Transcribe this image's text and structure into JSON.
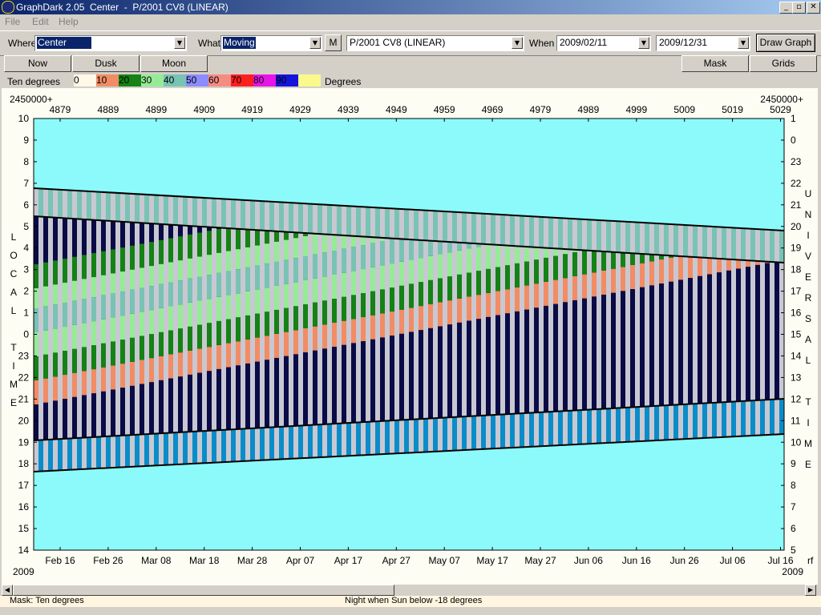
{
  "window": {
    "title": "GraphDark 2.05  Center  -  P/2001 CV8 (LINEAR)",
    "min_glyph": "_",
    "max_glyph": "▫",
    "close_glyph": "✕"
  },
  "menu": [
    {
      "label": "File"
    },
    {
      "label": "Edit"
    },
    {
      "label": "Help"
    }
  ],
  "toolbar": {
    "where_label": "Where",
    "where_value": "Center",
    "what_label": "What",
    "what_value": "Moving",
    "m_label": "M",
    "object_value": "P/2001 CV8 (LINEAR)",
    "when_label": "When",
    "start_date": "2009/02/11",
    "end_date": "2009/12/31",
    "draw_label": "Draw Graph"
  },
  "buttons": {
    "now": "Now",
    "dusk": "Dusk",
    "moon": "Moon",
    "mask": "Mask",
    "grids": "Grids"
  },
  "legend": {
    "title": "Ten degrees",
    "units": "Degrees",
    "entries": [
      {
        "label": "0",
        "color": "#fff8e6"
      },
      {
        "label": "10",
        "color": "#f28c64"
      },
      {
        "label": "20",
        "color": "#148214"
      },
      {
        "label": "30",
        "color": "#96eb96"
      },
      {
        "label": "40",
        "color": "#78c3b4"
      },
      {
        "label": "50",
        "color": "#8c8cff"
      },
      {
        "label": "60",
        "color": "#f58c82"
      },
      {
        "label": "70",
        "color": "#ff1e1e"
      },
      {
        "label": "80",
        "color": "#e614e6"
      },
      {
        "label": "90",
        "color": "#1414dc"
      },
      {
        "label": "",
        "color": "#fafa8c"
      }
    ]
  },
  "graph": {
    "jd_prefix_left": "2450000+",
    "jd_prefix_right": "2450000+",
    "jd_ticks": [
      "4879",
      "4889",
      "4899",
      "4909",
      "4919",
      "4929",
      "4939",
      "4949",
      "4959",
      "4969",
      "4979",
      "4989",
      "4999",
      "5009",
      "5019",
      "5029"
    ],
    "local_ticks": [
      "10",
      "9",
      "8",
      "7",
      "6",
      "5",
      "4",
      "3",
      "2",
      "1",
      "0",
      "23",
      "22",
      "21",
      "20",
      "19",
      "18",
      "17",
      "16",
      "15",
      "14"
    ],
    "ut_ticks": [
      "1",
      "0",
      "23",
      "22",
      "21",
      "20",
      "19",
      "18",
      "17",
      "16",
      "15",
      "14",
      "13",
      "12",
      "11",
      "10",
      "9",
      "8",
      "7",
      "6",
      "5"
    ],
    "date_ticks": [
      "Feb 16",
      "Feb 26",
      "Mar 08",
      "Mar 18",
      "Mar 28",
      "Apr 07",
      "Apr 17",
      "Apr 27",
      "May 07",
      "May 17",
      "May 27",
      "Jun 06",
      "Jun 16",
      "Jun 26",
      "Jul 06",
      "Jul 16"
    ],
    "year_left": "2009",
    "year_right": "2009",
    "corner_right": "rf",
    "left_axis_letters": [
      "L",
      "O",
      "C",
      "A",
      "L",
      "",
      "T",
      "I",
      "M",
      "E"
    ],
    "right_axis_letters": [
      "U",
      "N",
      "I",
      "V",
      "E",
      "R",
      "S",
      "A",
      "L",
      "",
      "T",
      "I",
      "M",
      "E"
    ],
    "colors": {
      "day": "#8cfafa",
      "night": "#0a0a46",
      "twilight": "#0a8cc8",
      "gray": "#c8c8d2"
    }
  },
  "status": {
    "mask": "Mask:  Ten degrees",
    "night": "Night when Sun below -18 degrees"
  }
}
